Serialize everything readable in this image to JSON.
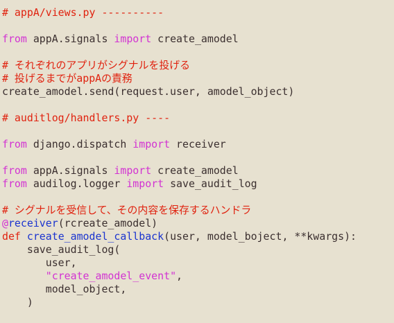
{
  "colors": {
    "background": "#e7e1d0",
    "comment": "#e0220f",
    "keyword": "#d232d2",
    "function_name": "#1a33cf",
    "text": "#3b2f2f"
  },
  "code_lines": [
    [
      {
        "text": "# appA/views.py ----------",
        "type": "comment"
      }
    ],
    [],
    [
      {
        "text": "from",
        "type": "keyword"
      },
      {
        "text": " appA.signals ",
        "type": "plain"
      },
      {
        "text": "import",
        "type": "keyword"
      },
      {
        "text": " create_amodel",
        "type": "plain"
      }
    ],
    [],
    [
      {
        "text": "# それぞれのアプリがシグナルを投げる",
        "type": "comment"
      }
    ],
    [
      {
        "text": "# 投げるまでがappAの責務",
        "type": "comment"
      }
    ],
    [
      {
        "text": "create_amodel.send(request.user, amodel_object)",
        "type": "plain"
      }
    ],
    [],
    [
      {
        "text": "# auditlog/handlers.py ----",
        "type": "comment"
      }
    ],
    [],
    [
      {
        "text": "from",
        "type": "keyword"
      },
      {
        "text": " django.dispatch ",
        "type": "plain"
      },
      {
        "text": "import",
        "type": "keyword"
      },
      {
        "text": " receiver",
        "type": "plain"
      }
    ],
    [],
    [
      {
        "text": "from",
        "type": "keyword"
      },
      {
        "text": " appA.signals ",
        "type": "plain"
      },
      {
        "text": "import",
        "type": "keyword"
      },
      {
        "text": " create_amodel",
        "type": "plain"
      }
    ],
    [
      {
        "text": "from",
        "type": "keyword"
      },
      {
        "text": " audilog.logger ",
        "type": "plain"
      },
      {
        "text": "import",
        "type": "keyword"
      },
      {
        "text": " save_audit_log",
        "type": "plain"
      }
    ],
    [],
    [
      {
        "text": "# シグナルを受信して、その内容を保存するハンドラ",
        "type": "comment"
      }
    ],
    [
      {
        "text": "@",
        "type": "decorator"
      },
      {
        "text": "receiver",
        "type": "name"
      },
      {
        "text": "(rcreate_amodel)",
        "type": "plain"
      }
    ],
    [
      {
        "text": "def",
        "type": "def"
      },
      {
        "text": " ",
        "type": "plain"
      },
      {
        "text": "create_amodel_callback",
        "type": "name"
      },
      {
        "text": "(user, model_boject, **kwargs):",
        "type": "plain"
      }
    ],
    [
      {
        "text": "    save_audit_log(",
        "type": "plain"
      }
    ],
    [
      {
        "text": "       user,",
        "type": "plain"
      }
    ],
    [
      {
        "text": "       ",
        "type": "plain"
      },
      {
        "text": "\"create_amodel_event\"",
        "type": "string"
      },
      {
        "text": ",",
        "type": "plain"
      }
    ],
    [
      {
        "text": "       model_object,",
        "type": "plain"
      }
    ],
    [
      {
        "text": "    )",
        "type": "plain"
      }
    ]
  ]
}
